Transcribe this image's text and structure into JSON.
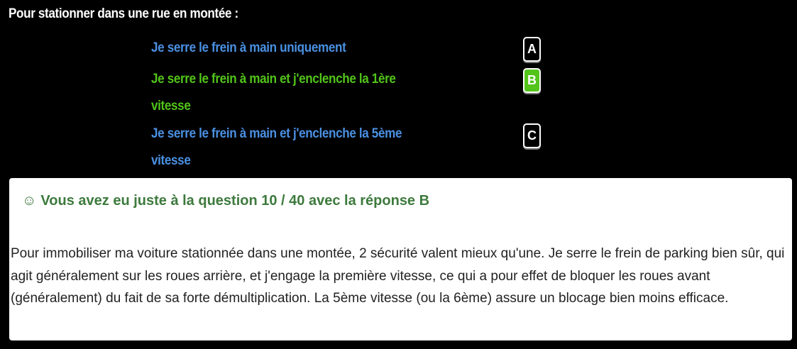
{
  "question": {
    "title": "Pour stationner dans une rue en montée :"
  },
  "answers": [
    {
      "letter": "A",
      "text": "Je serre le frein à main uniquement"
    },
    {
      "letter": "B",
      "text": "Je serre le frein à main et j'enclenche la 1ère vitesse",
      "selected": true
    },
    {
      "letter": "C",
      "text": "Je serre le frein à main et j'enclenche la 5ème vitesse"
    }
  ],
  "colors": {
    "answer_default": "#4a90e2",
    "answer_correct": "#52c41a",
    "result_headline": "#3d7a3d",
    "background": "#000000"
  },
  "result": {
    "icon": "smiley-icon",
    "icon_glyph": "☺",
    "headline": "Vous avez eu juste à la question 10 / 40 avec la réponse B",
    "explanation": "Pour immobiliser ma voiture stationnée dans une montée, 2 sécurité valent mieux qu'une. Je serre le frein de parking bien sûr, qui agit généralement sur les roues arrière, et j'engage la première vitesse, ce qui a pour effet de bloquer les roues avant (généralement) du fait de sa forte démultiplication. La 5ème vitesse (ou la 6ème) assure un blocage bien moins efficace."
  }
}
